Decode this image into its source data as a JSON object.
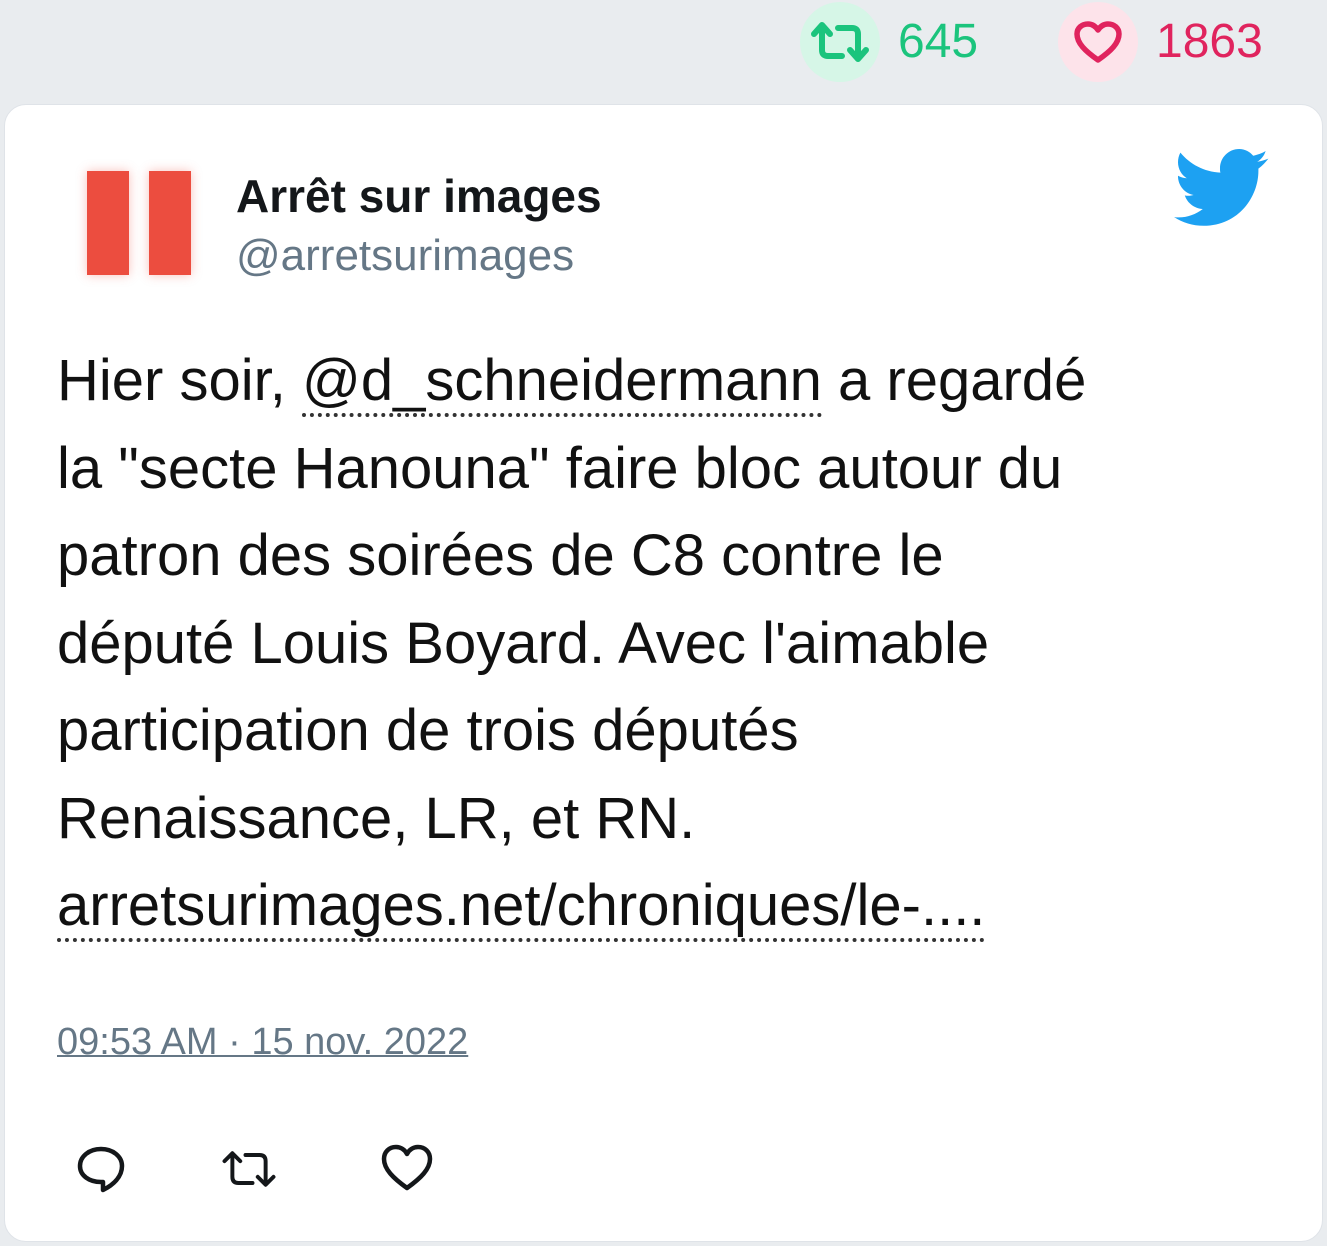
{
  "stats": {
    "retweet_count": "645",
    "like_count": "1863",
    "retweet_color": "#1bc47d",
    "like_color": "#e0245e"
  },
  "author": {
    "display_name": "Arrêt sur images",
    "handle": "@arretsurimages",
    "avatar_icon": "pause-bars-logo",
    "platform_icon": "twitter-bird-icon"
  },
  "tweet": {
    "prefix": "Hier soir, ",
    "mention": "@d_schneidermann",
    "after_mention": " a regardé",
    "line2": "la \"secte Hanouna\" faire bloc autour du",
    "line3": "patron des soirées de C8 contre le",
    "line4": "député Louis Boyard. Avec l'aimable",
    "line5": "participation de trois députés",
    "line6": "Renaissance, LR, et RN.",
    "link": "arretsurimages.net/chroniques/le-...."
  },
  "timestamp": "09:53 AM · 15 nov. 2022",
  "actions": {
    "reply_icon": "reply-icon",
    "retweet_icon": "retweet-icon",
    "like_icon": "heart-icon"
  }
}
